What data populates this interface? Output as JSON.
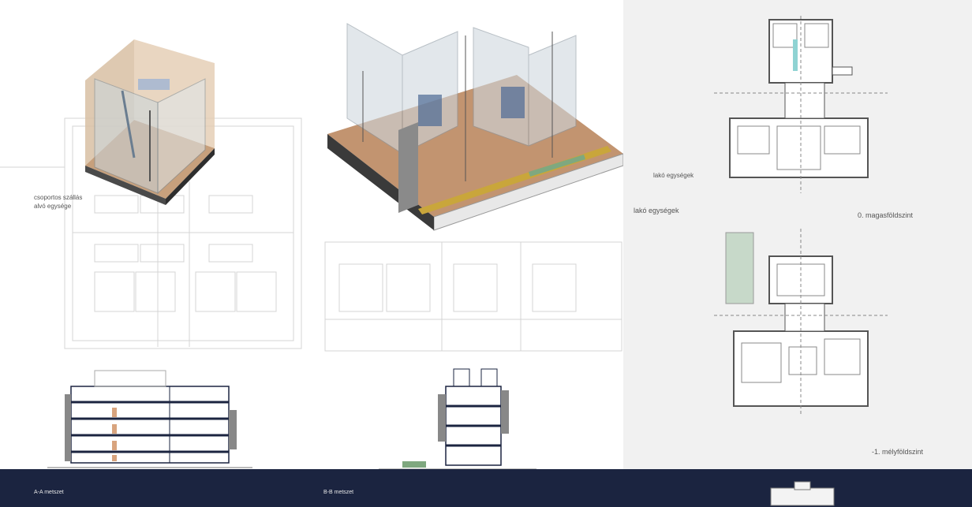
{
  "labels": {
    "group_hostel_line1": "csoportos szállás",
    "group_hostel_line2": "alvó egysége",
    "residential_units_1": "lakó egységek",
    "residential_units_2": "lakó egységek",
    "raised_ground_floor": "0. magasföldszint",
    "basement_floor": "-1. mélyföldszint",
    "section_aa": "A-A metszet",
    "section_bb": "B-B metszet"
  },
  "colors": {
    "footer": "#1b2440",
    "right_panel_bg": "#f1f1f1",
    "wood": "#b98a62",
    "glass": "#c9d6de",
    "wall_dark": "#1b2440",
    "green": "#7fa87f"
  }
}
